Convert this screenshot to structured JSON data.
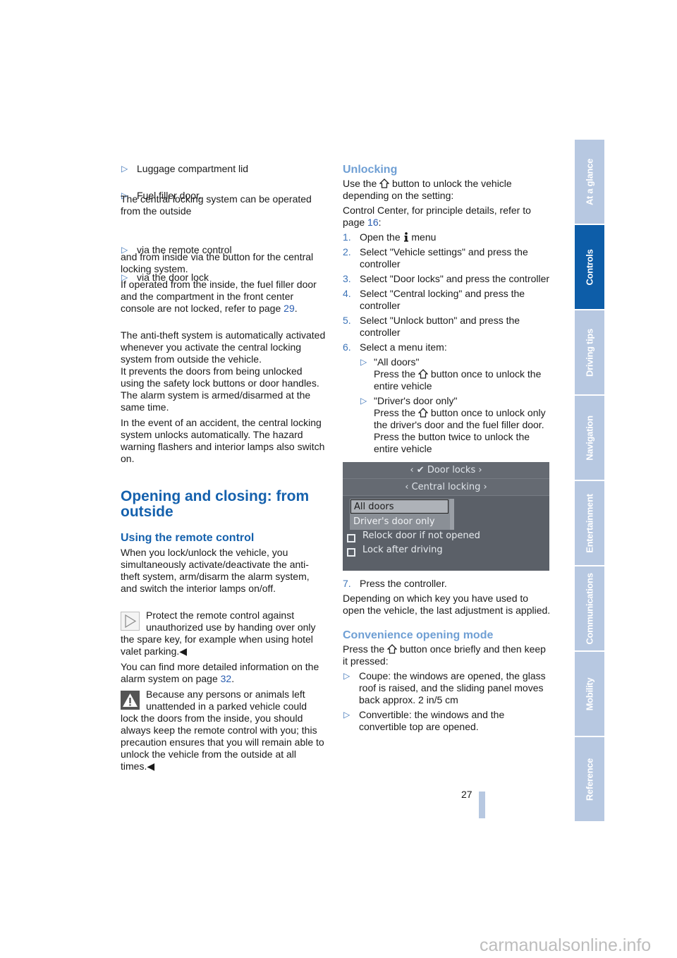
{
  "left": {
    "bullets_top": [
      "Luggage compartment lid",
      "Fuel filler door."
    ],
    "p_outside": "The central locking system can be operated from the outside",
    "bullets_via": [
      "via the remote control",
      "via the door lock"
    ],
    "p_inside": "and from inside via the button for the central locking system.",
    "p_operated": "If operated from the inside, the fuel filler door and the compartment in the front center console are not locked, refer to page ",
    "p_operated_link": "29",
    "p_operated_end": ".",
    "p_antitheft_1": "The anti-theft system is automatically activated whenever you activate the central locking system from outside the vehicle.",
    "p_antitheft_2": "It prevents the doors from being unlocked using the safety lock buttons or door handles. The alarm system is armed/disarmed at the same time.",
    "p_accident": "In the event of an accident, the central locking system unlocks automatically. The hazard warning flashers and interior lamps also switch on.",
    "h1": "Opening and closing: from outside",
    "h2": "Using the remote control",
    "p_remote": "When you lock/unlock the vehicle, you simultaneously activate/deactivate the anti-theft system, arm/disarm the alarm system, and switch the interior lamps on/off.",
    "note": "Protect the remote control against unauthorized use by handing over only the spare key, for example when using hotel valet parking.",
    "end_mark": "◀",
    "p_alarm": "You can find more detailed information on the alarm system on page ",
    "p_alarm_link": "32",
    "p_alarm_end": ".",
    "warning": "Because any persons or animals left unattended in a parked vehicle could lock the doors from the inside, you should always keep the remote control with you; this precaution ensures that you will remain able to unlock the vehicle from the outside at all times."
  },
  "right": {
    "h_unlocking": "Unlocking",
    "p_use_a": "Use the",
    "p_use_b": "button to unlock the vehicle depending on the setting:",
    "p_cc": "Control Center, for principle details, refer to page ",
    "p_cc_link": "16",
    "p_cc_end": ":",
    "steps": [
      {
        "n": "1.",
        "a": "Open the",
        "b": "menu"
      },
      {
        "n": "2.",
        "t": "Select \"Vehicle settings\" and press the controller"
      },
      {
        "n": "3.",
        "t": "Select \"Door locks\" and press the controller"
      },
      {
        "n": "4.",
        "t": "Select \"Central locking\" and press the controller"
      },
      {
        "n": "5.",
        "t": "Select \"Unlock button\" and press the controller"
      },
      {
        "n": "6.",
        "t": "Select a menu item:"
      }
    ],
    "sub1_title": "\"All doors\"",
    "sub1_a": "Press the",
    "sub1_b": "button once to unlock the entire vehicle",
    "sub2_title": "\"Driver's door only\"",
    "sub2_a": "Press the",
    "sub2_b": "button once to unlock only the driver's door and the fuel filler door.",
    "sub2_c": "Press the button twice to unlock the entire vehicle",
    "screen": {
      "header": "Door locks",
      "subheader": "Central locking",
      "options": [
        "All doors",
        "Driver's door only"
      ],
      "checkboxes": [
        "Relock door if not opened",
        "Lock after driving"
      ]
    },
    "step7": {
      "n": "7.",
      "t": "Press the controller."
    },
    "p_depending": "Depending on which key you have used to open the vehicle, the last adjustment is applied.",
    "h_convenience": "Convenience opening mode",
    "p_press_a": "Press the",
    "p_press_b": "button once briefly and then keep it pressed:",
    "bullets_conv": [
      "Coupe: the windows are opened, the glass roof is raised, and the sliding panel moves back approx. 2 in/5 cm",
      "Convertible: the windows and the convertible top are opened."
    ]
  },
  "page_number": "27",
  "tabs": [
    {
      "label": "At a glance",
      "active": false
    },
    {
      "label": "Controls",
      "active": true
    },
    {
      "label": "Driving tips",
      "active": false
    },
    {
      "label": "Navigation",
      "active": false
    },
    {
      "label": "Entertainment",
      "active": false
    },
    {
      "label": "Communications",
      "active": false
    },
    {
      "label": "Mobility",
      "active": false
    },
    {
      "label": "Reference",
      "active": false
    }
  ],
  "watermark": "carmanualsonline.info",
  "colors": {
    "heading": "#1561ad",
    "subheading": "#6f9fd4",
    "tab_active": "#0d5da8",
    "tab_inactive": "#b7c8e1"
  }
}
